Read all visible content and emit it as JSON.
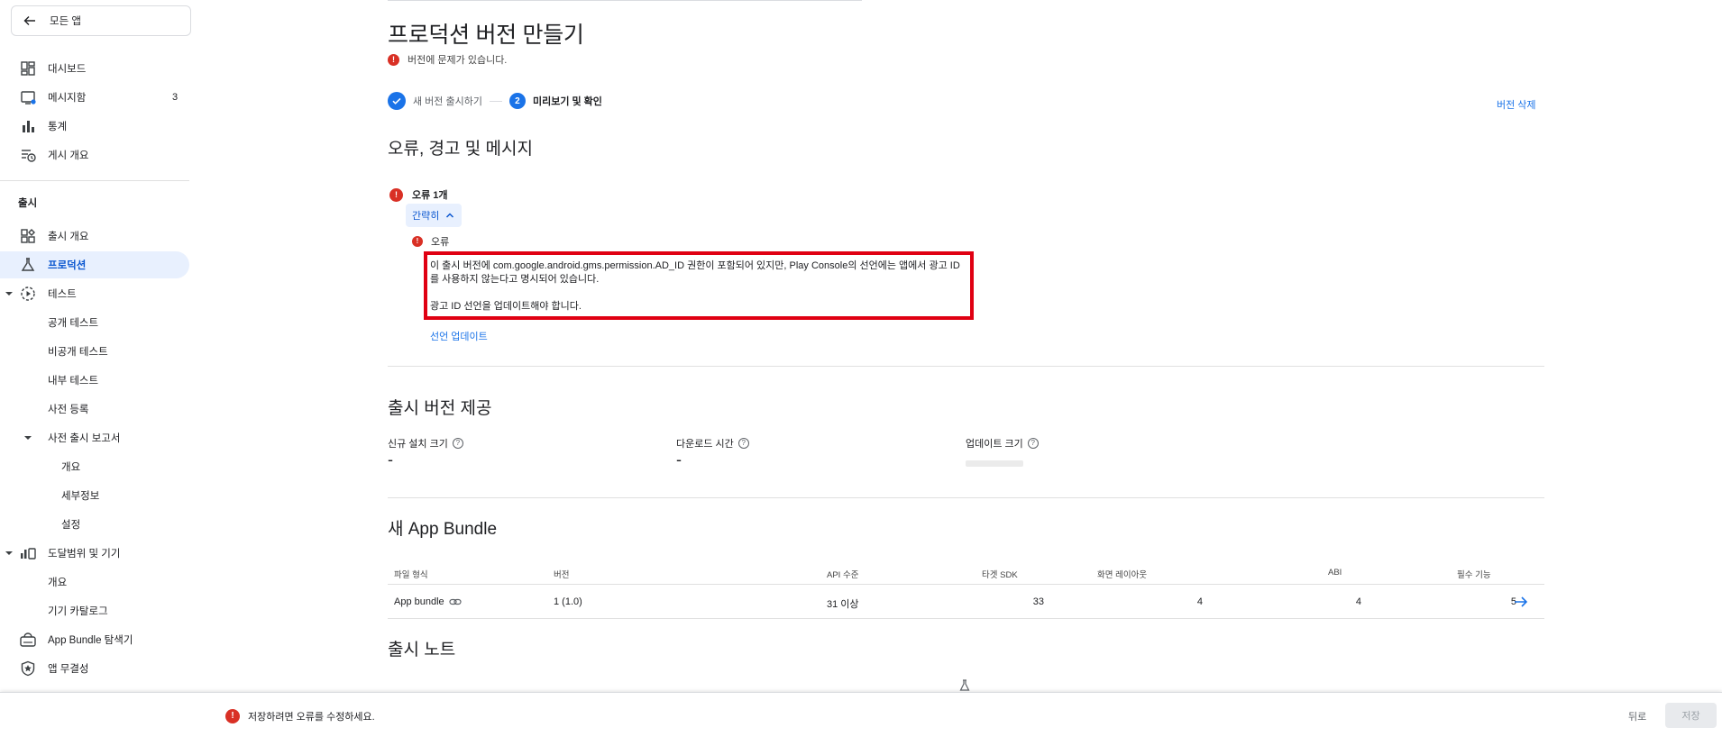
{
  "sidebar": {
    "back_label": "모든 앱",
    "items": [
      {
        "label": "대시보드",
        "icon": "dashboard-icon"
      },
      {
        "label": "메시지함",
        "icon": "inbox-icon",
        "count": "3"
      },
      {
        "label": "통계",
        "icon": "bar-chart-icon"
      },
      {
        "label": "게시 개요",
        "icon": "publishing-overview-icon"
      }
    ],
    "release_section": "출시",
    "release_items": [
      {
        "label": "출시 개요",
        "icon": "release-overview-icon"
      },
      {
        "label": "프로덕션",
        "icon": "production-flask-icon"
      },
      {
        "label": "테스트",
        "icon": "testing-icon"
      },
      {
        "label": "공개 테스트"
      },
      {
        "label": "비공개 테스트"
      },
      {
        "label": "내부 테스트"
      },
      {
        "label": "사전 등록"
      },
      {
        "label": "사전 출시 보고서"
      },
      {
        "label": "개요"
      },
      {
        "label": "세부정보"
      },
      {
        "label": "설정"
      },
      {
        "label": "도달범위 및 기기",
        "icon": "reach-devices-icon"
      },
      {
        "label": "개요"
      },
      {
        "label": "기기 카탈로그"
      },
      {
        "label": "App Bundle 탐색기",
        "icon": "app-bundle-explorer-icon"
      },
      {
        "label": "앱 무결성",
        "icon": "app-integrity-icon"
      }
    ]
  },
  "page": {
    "title": "프로덕션 버전 만들기",
    "version_issue": "버전에 문제가 있습니다.",
    "step1": "새 버전 출시하기",
    "step2_num": "2",
    "step2": "미리보기 및 확인",
    "delete_link": "버전 삭제"
  },
  "errors": {
    "heading": "오류, 경고 및 메시지",
    "count_label": "오류 1개",
    "collapse_label": "간략히",
    "item_label": "오류",
    "message1": "이 출시 버전에 com.google.android.gms.permission.AD_ID 권한이 포함되어 있지만, Play Console의 선언에는 앱에서 광고 ID를 사용하지 않는다고 명시되어 있습니다.",
    "message2": "광고 ID 선언을 업데이트해야 합니다.",
    "update_link": "선언 업데이트"
  },
  "delivery": {
    "heading": "출시 버전 제공",
    "new_install_label": "신규 설치 크기",
    "new_install_value": "-",
    "download_time_label": "다운로드 시간",
    "download_time_value": "-",
    "update_size_label": "업데이트 크기"
  },
  "bundle": {
    "heading": "새 App Bundle",
    "columns": [
      "파일 형식",
      "버전",
      "API 수준",
      "타겟 SDK",
      "화면 레이아웃",
      "ABI",
      "필수 기능"
    ],
    "row": {
      "file_type": "App bundle",
      "version": "1 (1.0)",
      "api": "31 이상",
      "target_sdk": "33",
      "layouts": "4",
      "abi": "4",
      "features": "5"
    }
  },
  "notes": {
    "heading": "출시 노트"
  },
  "footer": {
    "error_text": "저장하려면 오류를 수정하세요.",
    "back_label": "뒤로",
    "save_label": "저장"
  },
  "colors": {
    "accent": "#1a73e8",
    "error": "#d93025",
    "highlight_box": "#e00012"
  }
}
